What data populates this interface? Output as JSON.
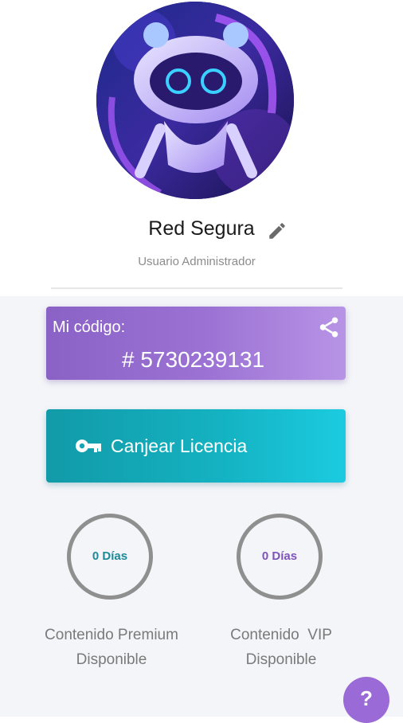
{
  "profile": {
    "name": "Red Segura",
    "role": "Usuario Administrador"
  },
  "code_card": {
    "label": "Mi código:",
    "value": "# 5730239131"
  },
  "license": {
    "label": "Canjear Licencia"
  },
  "premium": {
    "days": "0 Días",
    "caption_line1": "Contenido Premium",
    "caption_line2": "Disponible",
    "color": "#1c8a99"
  },
  "vip": {
    "days": "0 Días",
    "caption_line1": "Contenido  VIP",
    "caption_line2": "Disponible",
    "color": "#7d55b8"
  },
  "help": {
    "label": "?"
  },
  "icons": [
    "pencil-icon",
    "share-icon",
    "key-icon",
    "robot-avatar"
  ]
}
